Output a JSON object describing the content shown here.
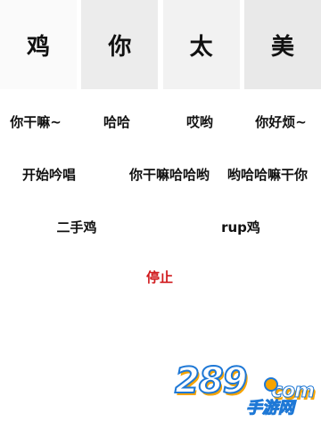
{
  "keys": [
    {
      "label": "鸡"
    },
    {
      "label": "你"
    },
    {
      "label": "太"
    },
    {
      "label": "美"
    }
  ],
  "sounds": {
    "row1": [
      "你干嘛~",
      "哈哈",
      "哎哟",
      "你好烦~"
    ],
    "row2": [
      "开始吟唱",
      "你干嘛哈哈哟",
      "哟哈哈嘛干你"
    ],
    "row3": [
      "二手鸡",
      "rup鸡"
    ]
  },
  "stop_label": "停止",
  "watermark": {
    "main": "289",
    "dotcom": "com",
    "sub": "手游网"
  },
  "colors": {
    "stop": "#d0191c",
    "watermark_blue": "#1e78d6",
    "watermark_orange": "#f6a400"
  }
}
